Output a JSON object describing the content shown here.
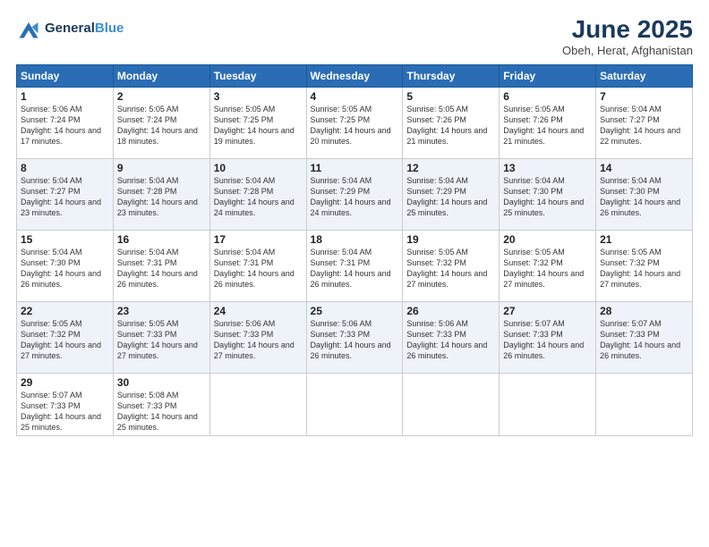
{
  "header": {
    "logo_line1": "General",
    "logo_line2": "Blue",
    "title": "June 2025",
    "subtitle": "Obeh, Herat, Afghanistan"
  },
  "weekdays": [
    "Sunday",
    "Monday",
    "Tuesday",
    "Wednesday",
    "Thursday",
    "Friday",
    "Saturday"
  ],
  "weeks": [
    [
      {
        "day": 1,
        "sunrise": "5:06 AM",
        "sunset": "7:24 PM",
        "daylight": "14 hours and 17 minutes."
      },
      {
        "day": 2,
        "sunrise": "5:05 AM",
        "sunset": "7:24 PM",
        "daylight": "14 hours and 18 minutes."
      },
      {
        "day": 3,
        "sunrise": "5:05 AM",
        "sunset": "7:25 PM",
        "daylight": "14 hours and 19 minutes."
      },
      {
        "day": 4,
        "sunrise": "5:05 AM",
        "sunset": "7:25 PM",
        "daylight": "14 hours and 20 minutes."
      },
      {
        "day": 5,
        "sunrise": "5:05 AM",
        "sunset": "7:26 PM",
        "daylight": "14 hours and 21 minutes."
      },
      {
        "day": 6,
        "sunrise": "5:05 AM",
        "sunset": "7:26 PM",
        "daylight": "14 hours and 21 minutes."
      },
      {
        "day": 7,
        "sunrise": "5:04 AM",
        "sunset": "7:27 PM",
        "daylight": "14 hours and 22 minutes."
      }
    ],
    [
      {
        "day": 8,
        "sunrise": "5:04 AM",
        "sunset": "7:27 PM",
        "daylight": "14 hours and 23 minutes."
      },
      {
        "day": 9,
        "sunrise": "5:04 AM",
        "sunset": "7:28 PM",
        "daylight": "14 hours and 23 minutes."
      },
      {
        "day": 10,
        "sunrise": "5:04 AM",
        "sunset": "7:28 PM",
        "daylight": "14 hours and 24 minutes."
      },
      {
        "day": 11,
        "sunrise": "5:04 AM",
        "sunset": "7:29 PM",
        "daylight": "14 hours and 24 minutes."
      },
      {
        "day": 12,
        "sunrise": "5:04 AM",
        "sunset": "7:29 PM",
        "daylight": "14 hours and 25 minutes."
      },
      {
        "day": 13,
        "sunrise": "5:04 AM",
        "sunset": "7:30 PM",
        "daylight": "14 hours and 25 minutes."
      },
      {
        "day": 14,
        "sunrise": "5:04 AM",
        "sunset": "7:30 PM",
        "daylight": "14 hours and 26 minutes."
      }
    ],
    [
      {
        "day": 15,
        "sunrise": "5:04 AM",
        "sunset": "7:30 PM",
        "daylight": "14 hours and 26 minutes."
      },
      {
        "day": 16,
        "sunrise": "5:04 AM",
        "sunset": "7:31 PM",
        "daylight": "14 hours and 26 minutes."
      },
      {
        "day": 17,
        "sunrise": "5:04 AM",
        "sunset": "7:31 PM",
        "daylight": "14 hours and 26 minutes."
      },
      {
        "day": 18,
        "sunrise": "5:04 AM",
        "sunset": "7:31 PM",
        "daylight": "14 hours and 26 minutes."
      },
      {
        "day": 19,
        "sunrise": "5:05 AM",
        "sunset": "7:32 PM",
        "daylight": "14 hours and 27 minutes."
      },
      {
        "day": 20,
        "sunrise": "5:05 AM",
        "sunset": "7:32 PM",
        "daylight": "14 hours and 27 minutes."
      },
      {
        "day": 21,
        "sunrise": "5:05 AM",
        "sunset": "7:32 PM",
        "daylight": "14 hours and 27 minutes."
      }
    ],
    [
      {
        "day": 22,
        "sunrise": "5:05 AM",
        "sunset": "7:32 PM",
        "daylight": "14 hours and 27 minutes."
      },
      {
        "day": 23,
        "sunrise": "5:05 AM",
        "sunset": "7:33 PM",
        "daylight": "14 hours and 27 minutes."
      },
      {
        "day": 24,
        "sunrise": "5:06 AM",
        "sunset": "7:33 PM",
        "daylight": "14 hours and 27 minutes."
      },
      {
        "day": 25,
        "sunrise": "5:06 AM",
        "sunset": "7:33 PM",
        "daylight": "14 hours and 26 minutes."
      },
      {
        "day": 26,
        "sunrise": "5:06 AM",
        "sunset": "7:33 PM",
        "daylight": "14 hours and 26 minutes."
      },
      {
        "day": 27,
        "sunrise": "5:07 AM",
        "sunset": "7:33 PM",
        "daylight": "14 hours and 26 minutes."
      },
      {
        "day": 28,
        "sunrise": "5:07 AM",
        "sunset": "7:33 PM",
        "daylight": "14 hours and 26 minutes."
      }
    ],
    [
      {
        "day": 29,
        "sunrise": "5:07 AM",
        "sunset": "7:33 PM",
        "daylight": "14 hours and 25 minutes."
      },
      {
        "day": 30,
        "sunrise": "5:08 AM",
        "sunset": "7:33 PM",
        "daylight": "14 hours and 25 minutes."
      },
      null,
      null,
      null,
      null,
      null
    ]
  ]
}
